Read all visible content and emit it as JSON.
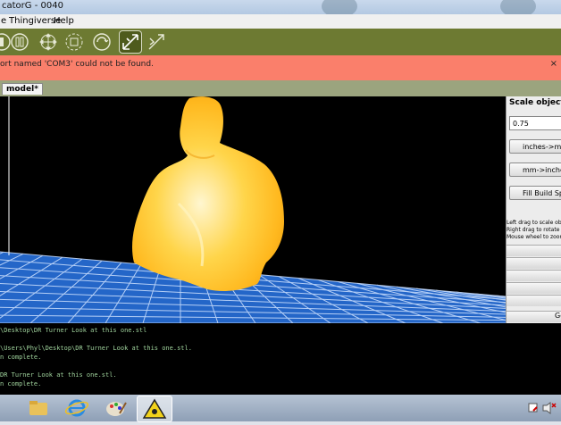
{
  "window": {
    "title": "catorG - 0040"
  },
  "menu": {
    "items": [
      "e",
      "Thingiverse",
      "Help"
    ]
  },
  "toolbar": {
    "buttons": [
      "build-icon",
      "pause-icon",
      "move-icon",
      "rotate-icon",
      "scale-icon",
      "mirror-icon"
    ],
    "active": "scale-icon"
  },
  "error": {
    "message": "ort named 'COM3' could not be found.",
    "close": "×"
  },
  "tabs": [
    {
      "label": "model*"
    }
  ],
  "panel": {
    "title": "Scale object",
    "scale_value": "0.75",
    "inches_to_mm": "inches->mm",
    "mm_to_inches": "mm->inches",
    "fill_build_space": "Fill Build Spac",
    "hints": [
      "Left drag to scale obje",
      "Right drag to rotate vi",
      "Mouse wheel to zoom"
    ],
    "bottom_button": "Ge"
  },
  "console": {
    "lines": [
      "\\Desktop\\DR Turner Look at this one.stl",
      "",
      "\\Users\\Phyl\\Desktop\\DR Turner Look at this one.stl.",
      "n complete.",
      "",
      "DR Turner Look at this one.stl.",
      "n complete."
    ]
  },
  "taskbar": {
    "items": [
      "folder-icon",
      "ie-icon",
      "paint-icon",
      "replicatorg-icon"
    ],
    "active": "replicatorg-icon"
  },
  "colors": {
    "toolbar": "#6d7a32",
    "error": "#fa7f6b",
    "tabstrip": "#9ba47e",
    "grid": "#2f6fd6",
    "model": "#ffd24a"
  }
}
